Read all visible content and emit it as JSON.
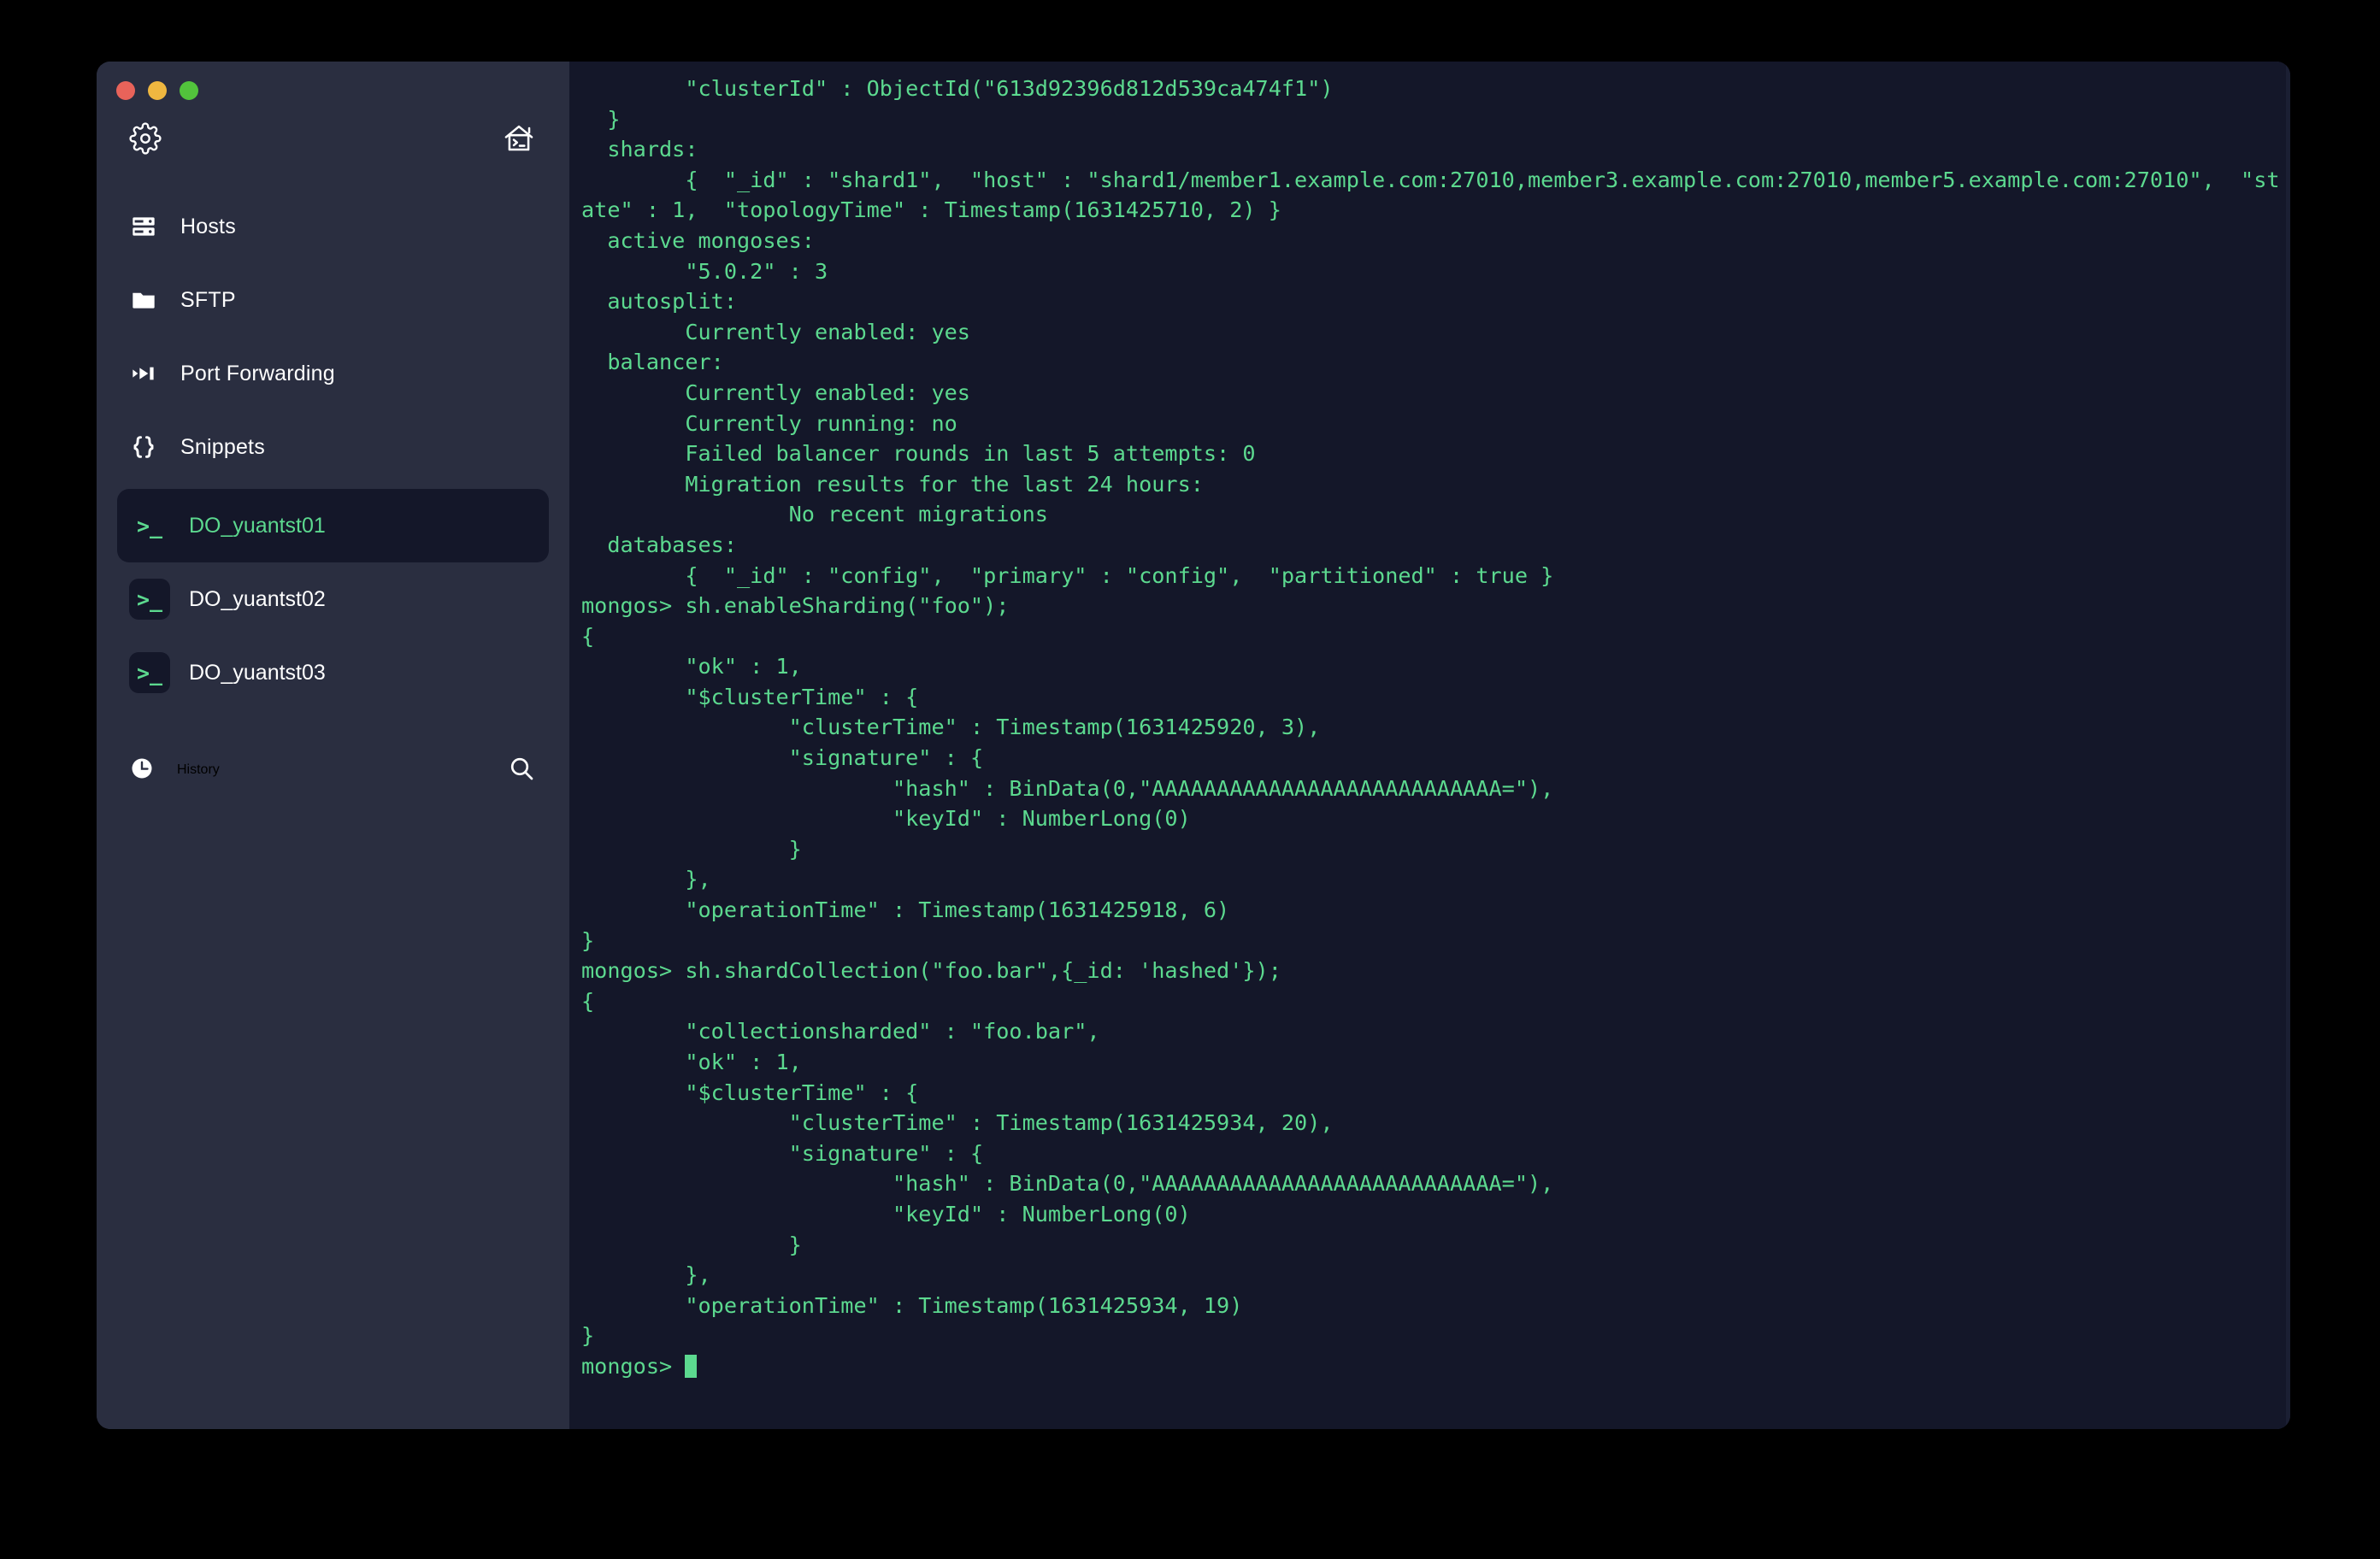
{
  "window": {
    "traffic_lights": [
      "close",
      "minimize",
      "maximize"
    ],
    "colors": {
      "sidebar_bg": "#2a2e40",
      "terminal_bg": "#141729",
      "accent_green": "#5cd98f",
      "text_white": "#ffffff",
      "close": "#e8635a",
      "minimize": "#efb740",
      "maximize": "#52c33c"
    }
  },
  "sidebar": {
    "toolbar": {
      "settings_icon": "gear-icon",
      "home_icon": "home-terminal-icon"
    },
    "nav_items": [
      {
        "label": "Hosts",
        "icon": "server-rack-icon"
      },
      {
        "label": "SFTP",
        "icon": "folder-icon"
      },
      {
        "label": "Port Forwarding",
        "icon": "forward-arrow-icon"
      },
      {
        "label": "Snippets",
        "icon": "curly-braces-icon"
      }
    ],
    "sessions": [
      {
        "label": "DO_yuantst01",
        "icon": "terminal-prompt-icon",
        "active": true
      },
      {
        "label": "DO_yuantst02",
        "icon": "terminal-prompt-icon",
        "active": false
      },
      {
        "label": "DO_yuantst03",
        "icon": "terminal-prompt-icon",
        "active": false
      }
    ],
    "history": {
      "label": "History",
      "icon": "clock-icon",
      "search_icon": "search-icon"
    }
  },
  "terminal": {
    "prompt": "mongos>",
    "cursor": "block",
    "lines": [
      "        \"clusterId\" : ObjectId(\"613d92396d812d539ca474f1\")",
      "  }",
      "  shards:",
      "        {  \"_id\" : \"shard1\",  \"host\" : \"shard1/member1.example.com:27010,member3.example.com:27010,member5.example.com:27010\",  \"state\" : 1,  \"topologyTime\" : Timestamp(1631425710, 2) }",
      "  active mongoses:",
      "        \"5.0.2\" : 3",
      "  autosplit:",
      "        Currently enabled: yes",
      "  balancer:",
      "        Currently enabled: yes",
      "        Currently running: no",
      "        Failed balancer rounds in last 5 attempts: 0",
      "        Migration results for the last 24 hours:",
      "                No recent migrations",
      "  databases:",
      "        {  \"_id\" : \"config\",  \"primary\" : \"config\",  \"partitioned\" : true }",
      "mongos> sh.enableSharding(\"foo\");",
      "{",
      "        \"ok\" : 1,",
      "        \"$clusterTime\" : {",
      "                \"clusterTime\" : Timestamp(1631425920, 3),",
      "                \"signature\" : {",
      "                        \"hash\" : BinData(0,\"AAAAAAAAAAAAAAAAAAAAAAAAAAA=\"),",
      "                        \"keyId\" : NumberLong(0)",
      "                }",
      "        },",
      "        \"operationTime\" : Timestamp(1631425918, 6)",
      "}",
      "mongos> sh.shardCollection(\"foo.bar\",{_id: 'hashed'});",
      "{",
      "        \"collectionsharded\" : \"foo.bar\",",
      "        \"ok\" : 1,",
      "        \"$clusterTime\" : {",
      "                \"clusterTime\" : Timestamp(1631425934, 20),",
      "                \"signature\" : {",
      "                        \"hash\" : BinData(0,\"AAAAAAAAAAAAAAAAAAAAAAAAAAA=\"),",
      "                        \"keyId\" : NumberLong(0)",
      "                }",
      "        },",
      "        \"operationTime\" : Timestamp(1631425934, 19)",
      "}"
    ]
  }
}
